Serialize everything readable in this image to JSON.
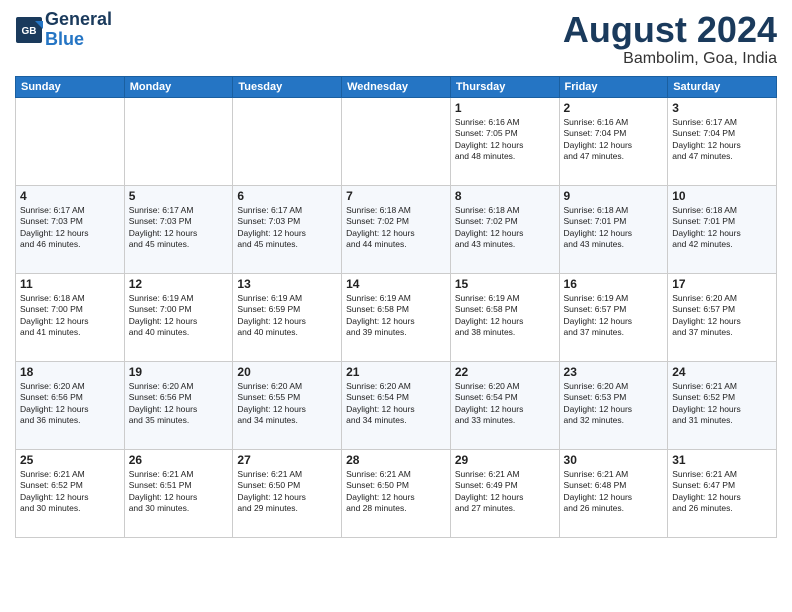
{
  "logo": {
    "text1": "General",
    "text2": "Blue"
  },
  "title": "August 2024",
  "location": "Bambolim, Goa, India",
  "days_of_week": [
    "Sunday",
    "Monday",
    "Tuesday",
    "Wednesday",
    "Thursday",
    "Friday",
    "Saturday"
  ],
  "weeks": [
    [
      {
        "day": "",
        "info": ""
      },
      {
        "day": "",
        "info": ""
      },
      {
        "day": "",
        "info": ""
      },
      {
        "day": "",
        "info": ""
      },
      {
        "day": "1",
        "info": "Sunrise: 6:16 AM\nSunset: 7:05 PM\nDaylight: 12 hours\nand 48 minutes."
      },
      {
        "day": "2",
        "info": "Sunrise: 6:16 AM\nSunset: 7:04 PM\nDaylight: 12 hours\nand 47 minutes."
      },
      {
        "day": "3",
        "info": "Sunrise: 6:17 AM\nSunset: 7:04 PM\nDaylight: 12 hours\nand 47 minutes."
      }
    ],
    [
      {
        "day": "4",
        "info": "Sunrise: 6:17 AM\nSunset: 7:03 PM\nDaylight: 12 hours\nand 46 minutes."
      },
      {
        "day": "5",
        "info": "Sunrise: 6:17 AM\nSunset: 7:03 PM\nDaylight: 12 hours\nand 45 minutes."
      },
      {
        "day": "6",
        "info": "Sunrise: 6:17 AM\nSunset: 7:03 PM\nDaylight: 12 hours\nand 45 minutes."
      },
      {
        "day": "7",
        "info": "Sunrise: 6:18 AM\nSunset: 7:02 PM\nDaylight: 12 hours\nand 44 minutes."
      },
      {
        "day": "8",
        "info": "Sunrise: 6:18 AM\nSunset: 7:02 PM\nDaylight: 12 hours\nand 43 minutes."
      },
      {
        "day": "9",
        "info": "Sunrise: 6:18 AM\nSunset: 7:01 PM\nDaylight: 12 hours\nand 43 minutes."
      },
      {
        "day": "10",
        "info": "Sunrise: 6:18 AM\nSunset: 7:01 PM\nDaylight: 12 hours\nand 42 minutes."
      }
    ],
    [
      {
        "day": "11",
        "info": "Sunrise: 6:18 AM\nSunset: 7:00 PM\nDaylight: 12 hours\nand 41 minutes."
      },
      {
        "day": "12",
        "info": "Sunrise: 6:19 AM\nSunset: 7:00 PM\nDaylight: 12 hours\nand 40 minutes."
      },
      {
        "day": "13",
        "info": "Sunrise: 6:19 AM\nSunset: 6:59 PM\nDaylight: 12 hours\nand 40 minutes."
      },
      {
        "day": "14",
        "info": "Sunrise: 6:19 AM\nSunset: 6:58 PM\nDaylight: 12 hours\nand 39 minutes."
      },
      {
        "day": "15",
        "info": "Sunrise: 6:19 AM\nSunset: 6:58 PM\nDaylight: 12 hours\nand 38 minutes."
      },
      {
        "day": "16",
        "info": "Sunrise: 6:19 AM\nSunset: 6:57 PM\nDaylight: 12 hours\nand 37 minutes."
      },
      {
        "day": "17",
        "info": "Sunrise: 6:20 AM\nSunset: 6:57 PM\nDaylight: 12 hours\nand 37 minutes."
      }
    ],
    [
      {
        "day": "18",
        "info": "Sunrise: 6:20 AM\nSunset: 6:56 PM\nDaylight: 12 hours\nand 36 minutes."
      },
      {
        "day": "19",
        "info": "Sunrise: 6:20 AM\nSunset: 6:56 PM\nDaylight: 12 hours\nand 35 minutes."
      },
      {
        "day": "20",
        "info": "Sunrise: 6:20 AM\nSunset: 6:55 PM\nDaylight: 12 hours\nand 34 minutes."
      },
      {
        "day": "21",
        "info": "Sunrise: 6:20 AM\nSunset: 6:54 PM\nDaylight: 12 hours\nand 34 minutes."
      },
      {
        "day": "22",
        "info": "Sunrise: 6:20 AM\nSunset: 6:54 PM\nDaylight: 12 hours\nand 33 minutes."
      },
      {
        "day": "23",
        "info": "Sunrise: 6:20 AM\nSunset: 6:53 PM\nDaylight: 12 hours\nand 32 minutes."
      },
      {
        "day": "24",
        "info": "Sunrise: 6:21 AM\nSunset: 6:52 PM\nDaylight: 12 hours\nand 31 minutes."
      }
    ],
    [
      {
        "day": "25",
        "info": "Sunrise: 6:21 AM\nSunset: 6:52 PM\nDaylight: 12 hours\nand 30 minutes."
      },
      {
        "day": "26",
        "info": "Sunrise: 6:21 AM\nSunset: 6:51 PM\nDaylight: 12 hours\nand 30 minutes."
      },
      {
        "day": "27",
        "info": "Sunrise: 6:21 AM\nSunset: 6:50 PM\nDaylight: 12 hours\nand 29 minutes."
      },
      {
        "day": "28",
        "info": "Sunrise: 6:21 AM\nSunset: 6:50 PM\nDaylight: 12 hours\nand 28 minutes."
      },
      {
        "day": "29",
        "info": "Sunrise: 6:21 AM\nSunset: 6:49 PM\nDaylight: 12 hours\nand 27 minutes."
      },
      {
        "day": "30",
        "info": "Sunrise: 6:21 AM\nSunset: 6:48 PM\nDaylight: 12 hours\nand 26 minutes."
      },
      {
        "day": "31",
        "info": "Sunrise: 6:21 AM\nSunset: 6:47 PM\nDaylight: 12 hours\nand 26 minutes."
      }
    ]
  ]
}
